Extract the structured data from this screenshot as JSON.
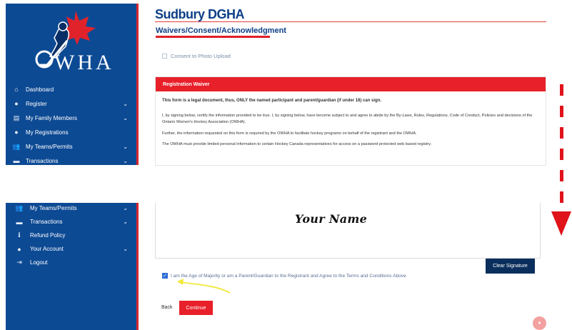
{
  "logo": {
    "text": "WHA",
    "alt": "OWHA"
  },
  "nav_top": [
    {
      "icon": "home-icon",
      "glyph": "⌂",
      "label": "Dashboard",
      "chevron": false
    },
    {
      "icon": "register-icon",
      "glyph": "●",
      "label": "Register",
      "chevron": true
    },
    {
      "icon": "family-card-icon",
      "glyph": "▤",
      "label": "My Family Members",
      "chevron": true
    },
    {
      "icon": "user-circle-icon",
      "glyph": "●",
      "label": "My Registrations",
      "chevron": false
    },
    {
      "icon": "users-icon",
      "glyph": "👥",
      "label": "My Teams/Permits",
      "chevron": true
    },
    {
      "icon": "money-icon",
      "glyph": "▬",
      "label": "Transactions",
      "chevron": true
    }
  ],
  "nav_bottom": [
    {
      "icon": "users-icon",
      "glyph": "👥",
      "label": "My Teams/Permits",
      "chevron": true
    },
    {
      "icon": "money-icon",
      "glyph": "▬",
      "label": "Transactions",
      "chevron": true
    },
    {
      "icon": "info-icon",
      "glyph": "ℹ",
      "label": "Refund Policy",
      "chevron": false
    },
    {
      "icon": "user-circle-icon",
      "glyph": "●",
      "label": "Your Account",
      "chevron": true
    },
    {
      "icon": "logout-icon",
      "glyph": "⇥",
      "label": "Logout",
      "chevron": false
    }
  ],
  "header": {
    "title": "Sudbury DGHA",
    "subtitle": "Waivers/Consent/Acknowledgment"
  },
  "photo_consent": {
    "label": "Consent to Photo Upload",
    "checked": false
  },
  "waiver": {
    "title": "Registration Waiver",
    "legal_notice": "This form is a legal document, thus, ONLY the named participant and parent/guardian (if under 18) can sign.",
    "paragraphs": [
      "I, by signing below, certify the information provided to be true. I, by signing below, have become subject to and agree to abide by the By-Laws, Rules, Regulations, Code of Conduct, Policies and decisions of the Ontario Women's Hockey Association (OWHA).",
      "Further, the information requested on this form is required by the OWHA to facilitate hockey programs on behalf of the registrant and the OWHA.",
      "The OWHA must provide limited personal information to certain Hockey Canada representatives for access on a password protected web based registry."
    ]
  },
  "signature": {
    "name": "Your Name",
    "clear_label": "Clear Signature"
  },
  "agree": {
    "label": "I am the Age of Majority or am a Parent/Guardian to the Registrant and Agree to the Terms and Conditions Above",
    "checked": true
  },
  "actions": {
    "back_label": "Back",
    "continue_label": "Continue"
  },
  "colors": {
    "brand_blue": "#0d4a94",
    "brand_red": "#e8202a",
    "dark_navy": "#0b2f5c",
    "annotation_yellow": "#f2e93a"
  }
}
